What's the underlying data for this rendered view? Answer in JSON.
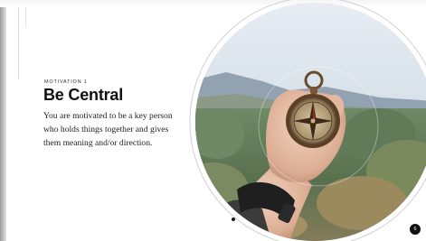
{
  "slide": {
    "kicker": "MOTIVATION 1",
    "title": "Be Central",
    "body": "You are motivated to be a key person who holds things together and gives them meaning and/or direction.",
    "page_number": "6"
  },
  "image": {
    "subject": "compass-in-hand-photo"
  },
  "colors": {
    "background": "#ffffff",
    "text": "#111111",
    "ring": "#cfcfcf"
  }
}
